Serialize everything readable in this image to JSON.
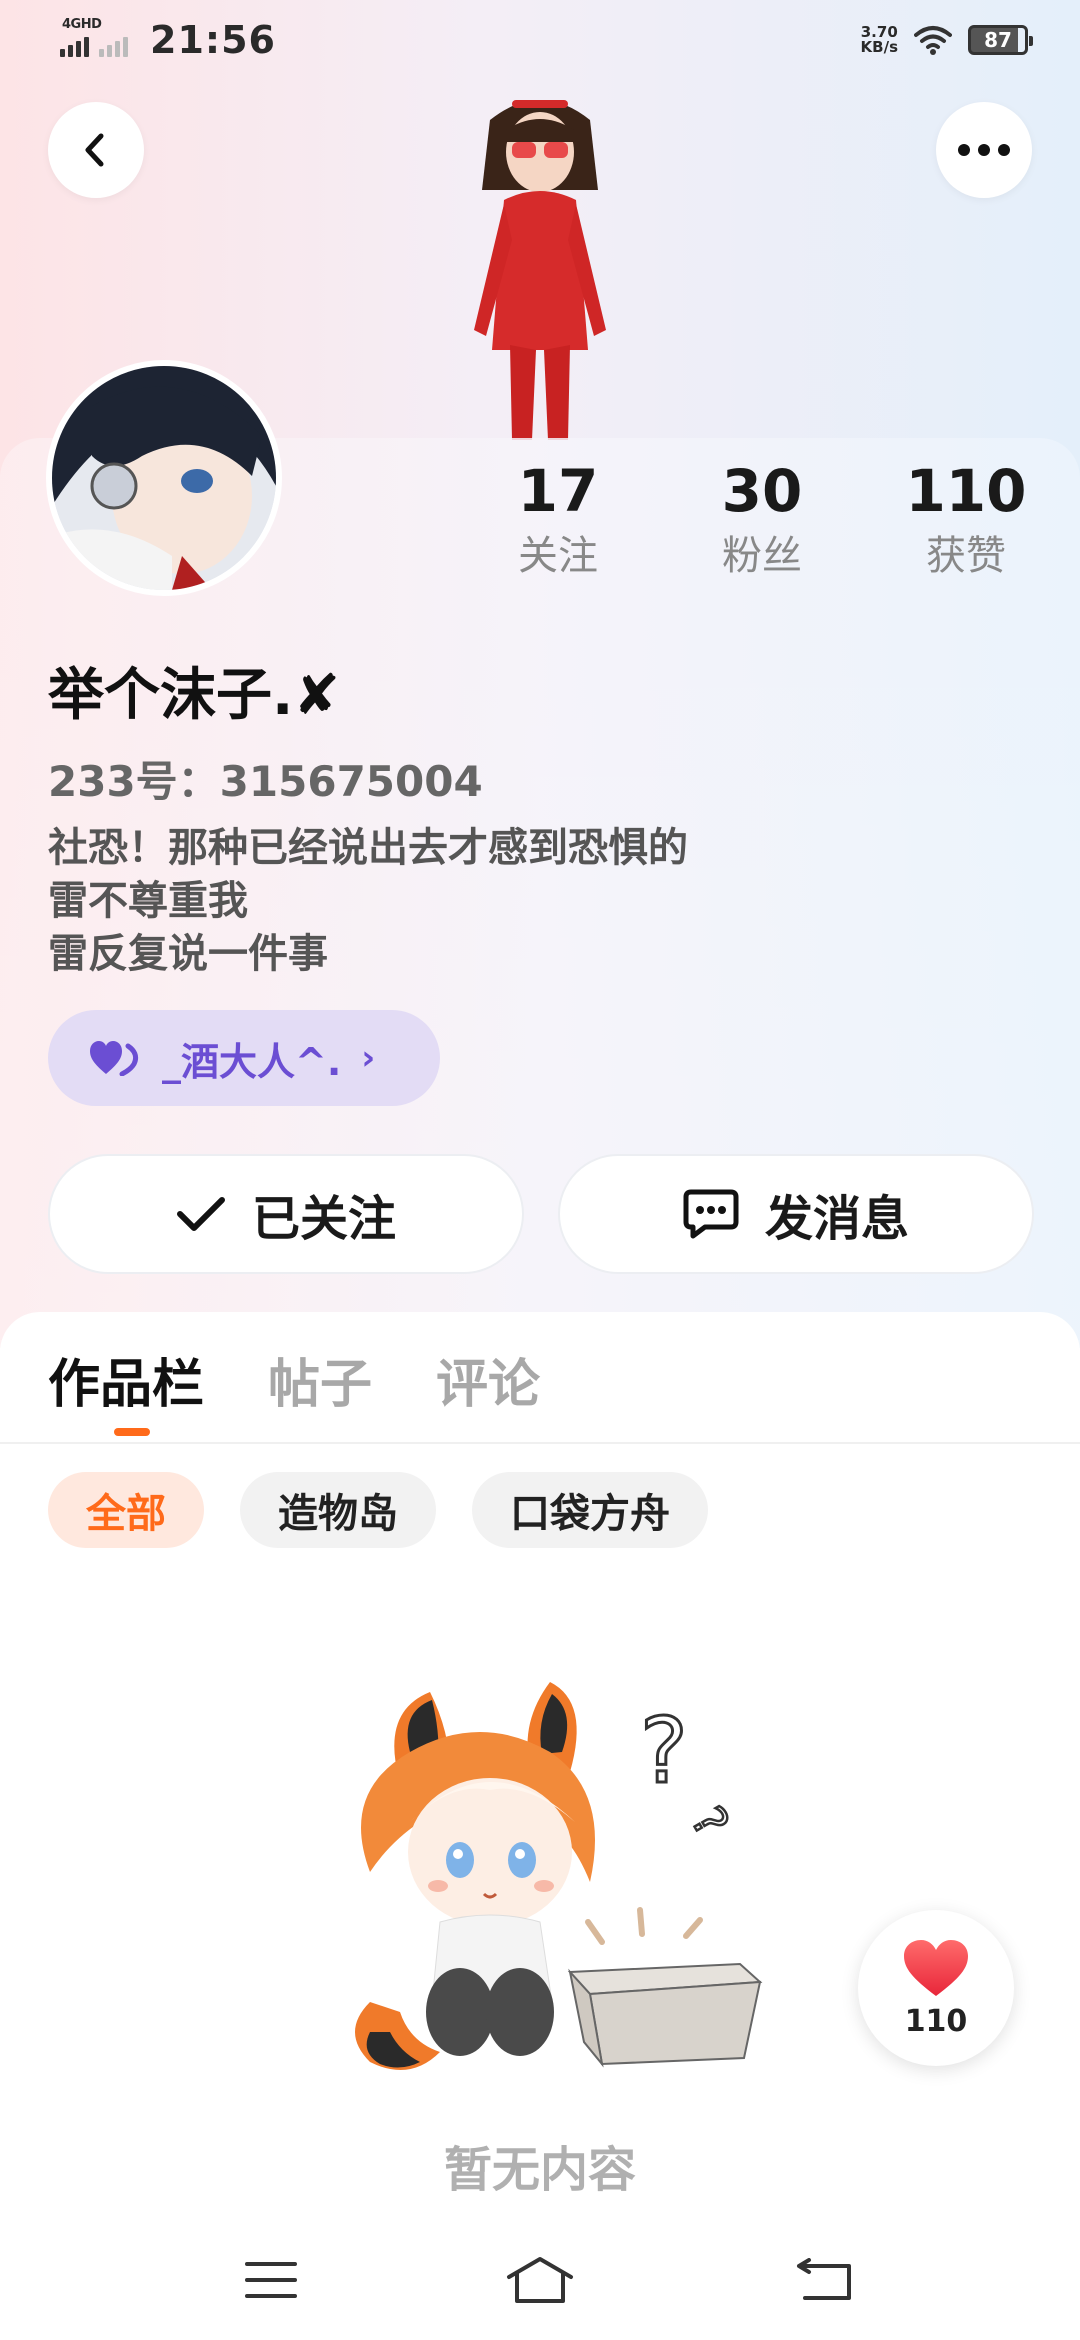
{
  "status_bar": {
    "network_label": "4GHD",
    "time": "21:56",
    "speed_value": "3.70",
    "speed_unit": "KB/s",
    "battery": "87"
  },
  "header": {
    "back_icon": "chevron-left-icon",
    "more_icon": "more-dots-icon"
  },
  "profile": {
    "stats": [
      {
        "value": "17",
        "label": "关注"
      },
      {
        "value": "30",
        "label": "粉丝"
      },
      {
        "value": "110",
        "label": "获赞"
      }
    ],
    "username": "举个沫子.✘",
    "uid": "233号：315675004",
    "bio_lines": [
      "社恐！那种已经说出去才感到恐惧的",
      "雷不尊重我",
      "雷反复说一件事"
    ],
    "relation_tag": {
      "label": "_酒大人^.",
      "icon": "double-heart-icon",
      "color": "#6b4ed3"
    },
    "follow_button": "已关注",
    "message_button": "发消息"
  },
  "content": {
    "tabs": [
      "作品栏",
      "帖子",
      "评论"
    ],
    "active_tab": 0,
    "filters": [
      "全部",
      "造物岛",
      "口袋方舟"
    ],
    "active_filter": 0,
    "empty_text": "暂无内容",
    "accent_color": "#ff6a1a"
  },
  "like_fab": {
    "count": "110",
    "icon": "heart-icon"
  },
  "nav": [
    "menu-icon",
    "home-icon",
    "back-icon"
  ]
}
